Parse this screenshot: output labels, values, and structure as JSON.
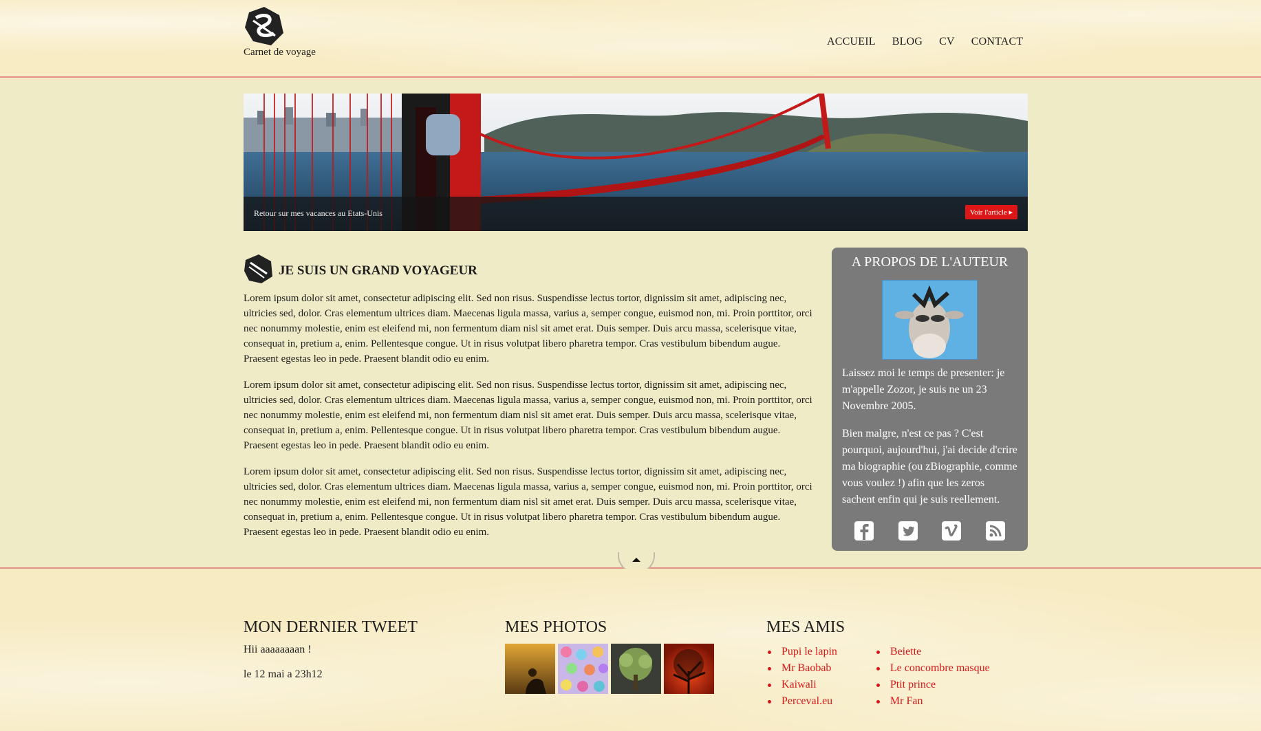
{
  "brand": {
    "name": "Carnet de voyage",
    "logo_icon": "zozor-logo-icon"
  },
  "nav": {
    "items": [
      "ACCUEIL",
      "BLOG",
      "CV",
      "CONTACT"
    ]
  },
  "banner": {
    "caption": "Retour sur mes vacances au Etats-Unis",
    "button_label": "Voir l'article ▸"
  },
  "article": {
    "title": "JE SUIS UN GRAND VOYAGEUR",
    "paragraphs": [
      "Lorem ipsum dolor sit amet, consectetur adipiscing elit. Sed non risus. Suspendisse lectus tortor, dignissim sit amet, adipiscing nec, ultricies sed, dolor. Cras elementum ultrices diam. Maecenas ligula massa, varius a, semper congue, euismod non, mi. Proin porttitor, orci nec nonummy molestie, enim est eleifend mi, non fermentum diam nisl sit amet erat. Duis semper. Duis arcu massa, scelerisque vitae, consequat in, pretium a, enim. Pellentesque congue. Ut in risus volutpat libero pharetra tempor. Cras vestibulum bibendum augue. Praesent egestas leo in pede. Praesent blandit odio eu enim.",
      "Lorem ipsum dolor sit amet, consectetur adipiscing elit. Sed non risus. Suspendisse lectus tortor, dignissim sit amet, adipiscing nec, ultricies sed, dolor. Cras elementum ultrices diam. Maecenas ligula massa, varius a, semper congue, euismod non, mi. Proin porttitor, orci nec nonummy molestie, enim est eleifend mi, non fermentum diam nisl sit amet erat. Duis semper. Duis arcu massa, scelerisque vitae, consequat in, pretium a, enim. Pellentesque congue. Ut in risus volutpat libero pharetra tempor. Cras vestibulum bibendum augue. Praesent egestas leo in pede. Praesent blandit odio eu enim.",
      "Lorem ipsum dolor sit amet, consectetur adipiscing elit. Sed non risus. Suspendisse lectus tortor, dignissim sit amet, adipiscing nec, ultricies sed, dolor. Cras elementum ultrices diam. Maecenas ligula massa, varius a, semper congue, euismod non, mi. Proin porttitor, orci nec nonummy molestie, enim est eleifend mi, non fermentum diam nisl sit amet erat. Duis semper. Duis arcu massa, scelerisque vitae, consequat in, pretium a, enim. Pellentesque congue. Ut in risus volutpat libero pharetra tempor. Cras vestibulum bibendum augue. Praesent egestas leo in pede. Praesent blandit odio eu enim."
    ]
  },
  "about": {
    "title": "A PROPOS DE L'AUTEUR",
    "paragraphs": [
      "Laissez moi le temps de presenter: je m'appelle Zozor, je suis ne un 23 Novembre 2005.",
      "Bien malgre, n'est ce pas ? C'est pourquoi, aujourd'hui, j'ai decide d'crire ma biographie (ou zBiographie, comme vous voulez !) afin que les zeros sachent enfin qui je suis reellement."
    ],
    "socials": [
      "facebook-icon",
      "twitter-icon",
      "vimeo-icon",
      "rss-icon"
    ]
  },
  "footer": {
    "tweet": {
      "title": "MON DERNIER TWEET",
      "text": "Hii aaaaaaaan !",
      "date": "le 12 mai a 23h12"
    },
    "photos": {
      "title": "MES PHOTOS"
    },
    "friends": {
      "title": "MES AMIS",
      "col1": [
        "Pupi le lapin",
        "Mr Baobab",
        "Kaiwali",
        "Perceval.eu"
      ],
      "col2": [
        "Beiette",
        "Le concombre masque",
        "Ptit prince",
        "Mr Fan"
      ]
    }
  },
  "colors": {
    "accent": "#dd1717",
    "rule": "#e29088",
    "aside_bg": "#7a7a7a",
    "main_bg": "#efebc7"
  }
}
